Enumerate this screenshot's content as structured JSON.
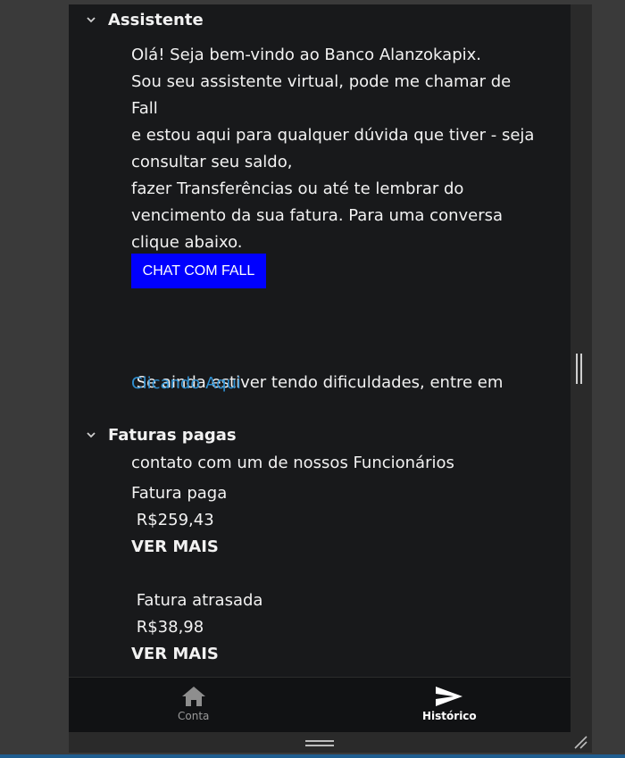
{
  "assistente": {
    "title": "Assistente",
    "lines": [
      "Olá! Seja bem-vindo ao Banco Alanzokapix.",
      "Sou seu assistente virtual, pode me chamar de Fall",
      "e estou aqui para qualquer dúvida que tiver - seja",
      "consultar seu saldo,",
      "fazer Transferências ou até te lembrar do",
      "vencimento da sua fatura. Para uma conversa",
      "clique abaixo."
    ],
    "chat_button": "CHAT COM FALL",
    "help_lines": [
      " Se ainda estiver tendo dificuldades, entre em",
      "contato com um de nossos Funcionários"
    ],
    "link": "Clicando Aqui"
  },
  "faturas": {
    "title": "Faturas pagas",
    "items": [
      {
        "label": "Fatura paga",
        "value": " R$259,43",
        "action": "VER MAIS"
      },
      {
        "label": " Fatura atrasada",
        "value": " R$38,98",
        "action": "VER MAIS"
      }
    ]
  },
  "nav": {
    "items": [
      {
        "label": "Conta",
        "icon": "home-icon",
        "active": false
      },
      {
        "label": "Histórico",
        "icon": "send-icon",
        "active": true
      }
    ]
  },
  "colors": {
    "chat_button": "#0000ff",
    "link": "#2f8fd0",
    "background": "#18191b"
  }
}
